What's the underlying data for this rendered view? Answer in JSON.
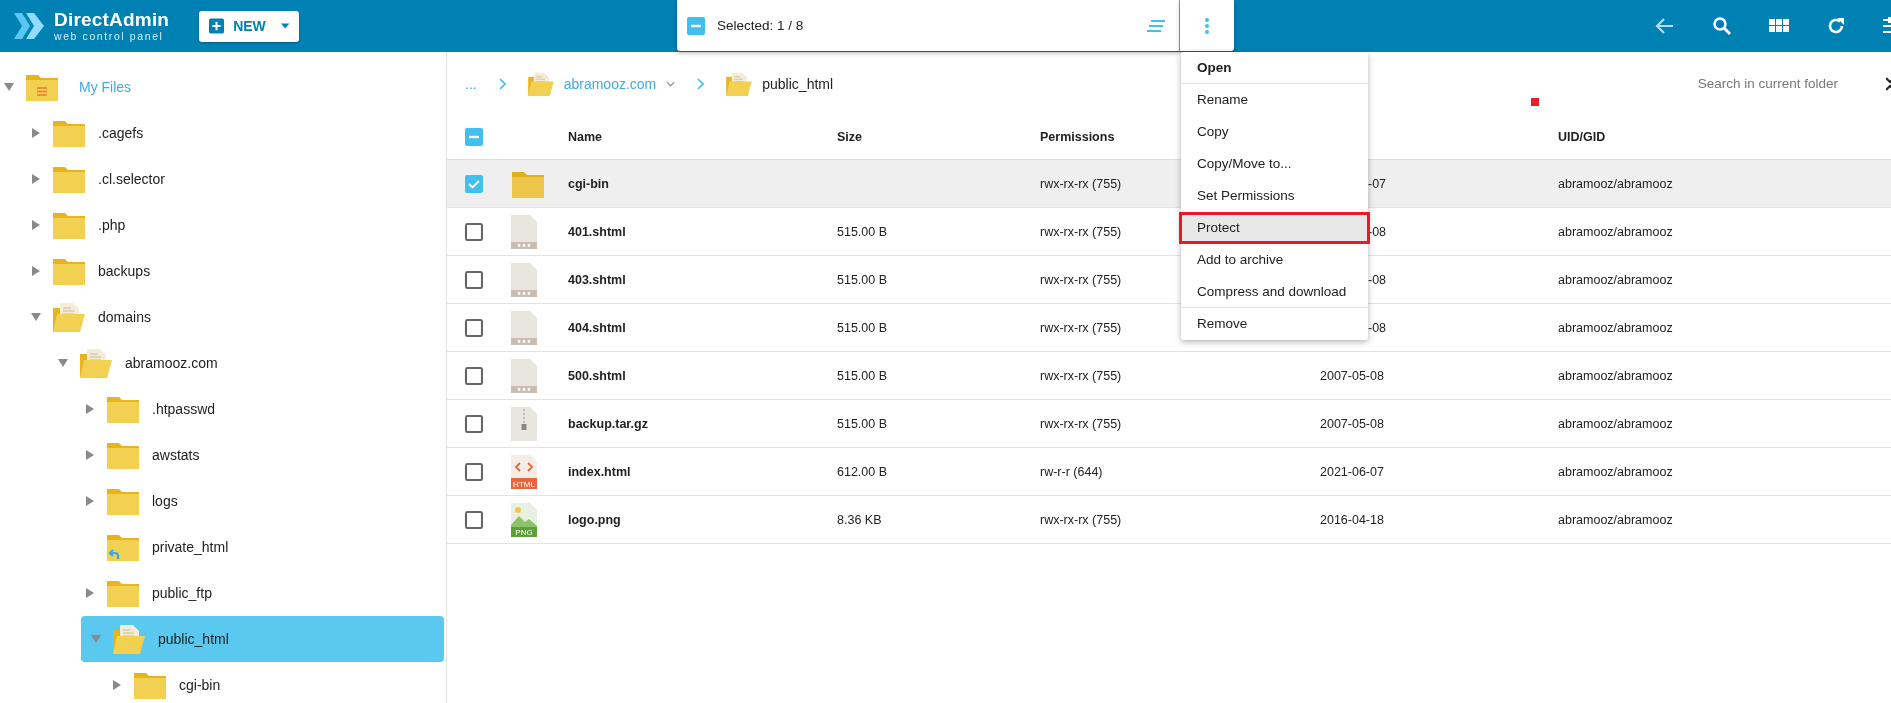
{
  "header": {
    "brand": "DirectAdmin",
    "tagline": "web control panel",
    "new_button": "NEW"
  },
  "selection": {
    "label": "Selected: 1 / 8",
    "indeterminate": true
  },
  "tree": [
    {
      "label": "My Files",
      "kind": "home",
      "expanded": true,
      "selected": false,
      "children": [
        {
          "label": ".cagefs",
          "kind": "folder",
          "expanded": false,
          "selected": false
        },
        {
          "label": ".cl.selector",
          "kind": "folder",
          "expanded": false,
          "selected": false
        },
        {
          "label": ".php",
          "kind": "folder",
          "expanded": false,
          "selected": false
        },
        {
          "label": "backups",
          "kind": "folder",
          "expanded": false,
          "selected": false
        },
        {
          "label": "domains",
          "kind": "open",
          "expanded": true,
          "selected": false,
          "children": [
            {
              "label": "abramooz.com",
              "kind": "open",
              "expanded": true,
              "selected": false,
              "children": [
                {
                  "label": ".htpasswd",
                  "kind": "folder",
                  "expanded": false,
                  "selected": false
                },
                {
                  "label": "awstats",
                  "kind": "folder",
                  "expanded": false,
                  "selected": false
                },
                {
                  "label": "logs",
                  "kind": "folder",
                  "expanded": false,
                  "selected": false
                },
                {
                  "label": "private_html",
                  "kind": "link",
                  "selected": false
                },
                {
                  "label": "public_ftp",
                  "kind": "folder",
                  "expanded": false,
                  "selected": false
                },
                {
                  "label": "public_html",
                  "kind": "open",
                  "expanded": true,
                  "selected": true,
                  "children": [
                    {
                      "label": "cgi-bin",
                      "kind": "folder",
                      "expanded": false,
                      "selected": false
                    }
                  ]
                }
              ]
            }
          ]
        }
      ]
    }
  ],
  "breadcrumb": [
    {
      "label": "...",
      "kind": "ellipsis"
    },
    {
      "label": "abramooz.com",
      "kind": "dropdown"
    },
    {
      "label": "public_html",
      "kind": "current"
    }
  ],
  "search": {
    "placeholder": "Search in current folder"
  },
  "table": {
    "indeterminate": true,
    "columns": {
      "name": "Name",
      "size": "Size",
      "permissions": "Permissions",
      "owner": "UID/GID"
    },
    "rows": [
      {
        "name": "cgi-bin",
        "kind": "folder",
        "permissions": "rwx-rx-rx (755)",
        "modified": "-07",
        "cut": true,
        "owner": "abramooz/abramooz",
        "selected": true
      },
      {
        "name": "401.shtml",
        "kind": "file",
        "size": "515.00 B",
        "permissions": "rwx-rx-rx (755)",
        "modified": "-08",
        "cut": true,
        "owner": "abramooz/abramooz",
        "selected": false
      },
      {
        "name": "403.shtml",
        "kind": "file",
        "size": "515.00 B",
        "permissions": "rwx-rx-rx (755)",
        "modified": "-08",
        "cut": true,
        "owner": "abramooz/abramooz",
        "selected": false
      },
      {
        "name": "404.shtml",
        "kind": "file",
        "size": "515.00 B",
        "permissions": "rwx-rx-rx (755)",
        "modified": "-08",
        "cut": true,
        "owner": "abramooz/abramooz",
        "selected": false
      },
      {
        "name": "500.shtml",
        "kind": "file",
        "size": "515.00 B",
        "permissions": "rwx-rx-rx (755)",
        "modified": "2007-05-08",
        "cut": false,
        "owner": "abramooz/abramooz",
        "selected": false
      },
      {
        "name": "backup.tar.gz",
        "kind": "archive",
        "size": "515.00 B",
        "permissions": "rwx-rx-rx (755)",
        "modified": "2007-05-08",
        "cut": false,
        "owner": "abramooz/abramooz",
        "selected": false
      },
      {
        "name": "index.html",
        "kind": "html",
        "icon_label": "HTML",
        "size": "612.00 B",
        "permissions": "rw-r-r (644)",
        "modified": "2021-06-07",
        "cut": false,
        "owner": "abramooz/abramooz",
        "selected": false
      },
      {
        "name": "logo.png",
        "kind": "image",
        "icon_label": "PNG",
        "size": "8.36 KB",
        "permissions": "rwx-rx-rx (755)",
        "modified": "2016-04-18",
        "cut": false,
        "owner": "abramooz/abramooz",
        "selected": false
      }
    ]
  },
  "menu": [
    {
      "label": "Open",
      "bold": true,
      "highlighted": false,
      "divider_after": true
    },
    {
      "label": "Rename",
      "bold": false,
      "highlighted": false,
      "divider_after": false
    },
    {
      "label": "Copy",
      "bold": false,
      "highlighted": false,
      "divider_after": false
    },
    {
      "label": "Copy/Move to...",
      "bold": false,
      "highlighted": false,
      "divider_after": false
    },
    {
      "label": "Set Permissions",
      "bold": false,
      "highlighted": false,
      "divider_after": false
    },
    {
      "label": "Protect",
      "bold": false,
      "highlighted": true,
      "divider_after": false
    },
    {
      "label": "Add to archive",
      "bold": false,
      "highlighted": false,
      "divider_after": false
    },
    {
      "label": "Compress and download",
      "bold": false,
      "highlighted": false,
      "divider_after": true
    },
    {
      "label": "Remove",
      "bold": false,
      "highlighted": false,
      "divider_after": false
    }
  ]
}
